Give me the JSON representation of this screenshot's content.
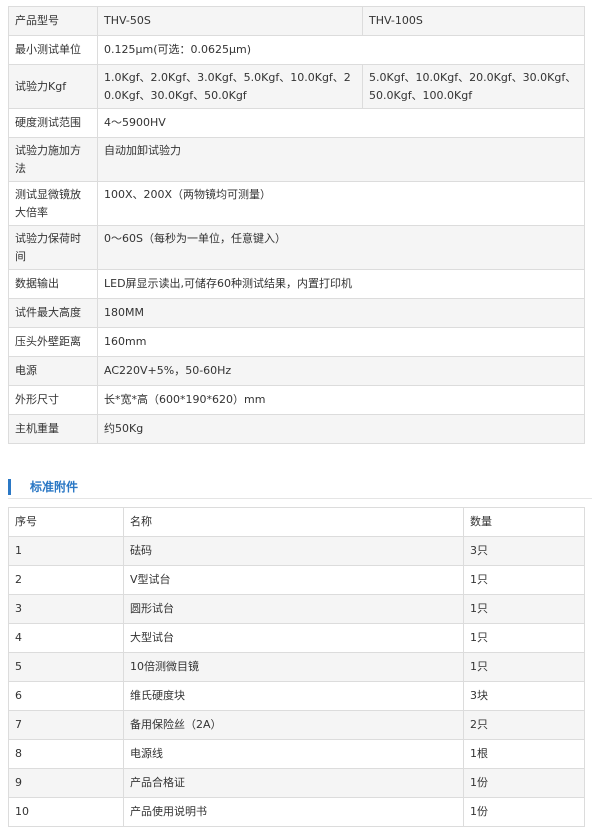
{
  "spec_table": {
    "header": {
      "label": "产品型号",
      "model_a": "THV-50S",
      "model_b": "THV-100S"
    },
    "min_unit": {
      "label": "最小测试单位",
      "value": "0.125μm(可选：0.0625μm)"
    },
    "test_force": {
      "label": "试验力Kgf",
      "value_a": "1.0Kgf、2.0Kgf、3.0Kgf、5.0Kgf、10.0Kgf、20.0Kgf、30.0Kgf、50.0Kgf",
      "value_b": "5.0Kgf、10.0Kgf、20.0Kgf、30.0Kgf、50.0Kgf、100.0Kgf"
    },
    "hardness_range": {
      "label": "硬度测试范围",
      "value": "4～5900HV"
    },
    "load_method": {
      "label": "试验力施加方法",
      "value": "自动加卸试验力"
    },
    "magnification": {
      "label": "测试显微镜放大倍率",
      "value": "100X、200X（两物镜均可测量）"
    },
    "dwell_time": {
      "label": "试验力保荷时间",
      "value": "0～60S（每秒为一单位，任意键入）"
    },
    "data_output": {
      "label": "数据输出",
      "value": "LED屏显示读出,可储存60种测试结果，内置打印机"
    },
    "max_height": {
      "label": "试件最大高度",
      "value": "180MM"
    },
    "throat_depth": {
      "label": "压头外壁距离",
      "value": "160mm"
    },
    "power": {
      "label": "电源",
      "value": "AC220V+5%，50-60Hz"
    },
    "dimensions": {
      "label": "外形尺寸",
      "value": "长*宽*高（600*190*620）mm"
    },
    "weight": {
      "label": "主机重量",
      "value": "约50Kg"
    }
  },
  "section": {
    "title": "标准附件"
  },
  "accessories": {
    "headers": {
      "no": "序号",
      "name": "名称",
      "qty": "数量"
    },
    "rows": [
      {
        "no": "1",
        "name": "砝码",
        "qty": "3只"
      },
      {
        "no": "2",
        "name": "V型试台",
        "qty": "1只"
      },
      {
        "no": "3",
        "name": "圆形试台",
        "qty": "1只"
      },
      {
        "no": "4",
        "name": "大型试台",
        "qty": "1只"
      },
      {
        "no": "5",
        "name": "10倍测微目镜",
        "qty": "1只"
      },
      {
        "no": "6",
        "name": "维氏硬度块",
        "qty": "3块"
      },
      {
        "no": "7",
        "name": "备用保险丝（2A）",
        "qty": "2只"
      },
      {
        "no": "8",
        "name": "电源线",
        "qty": "1根"
      },
      {
        "no": "9",
        "name": "产品合格证",
        "qty": "1份"
      },
      {
        "no": "10",
        "name": "产品使用说明书",
        "qty": "1份"
      }
    ]
  }
}
